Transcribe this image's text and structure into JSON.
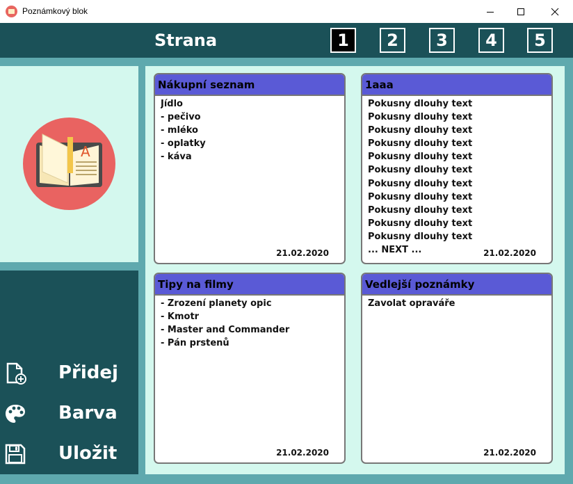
{
  "window": {
    "title": "Poznámkový blok",
    "app_icon": "notebook-app-icon",
    "controls": [
      "minimize-icon",
      "maximize-icon",
      "close-icon"
    ]
  },
  "header": {
    "label": "Strana",
    "pages": [
      "1",
      "2",
      "3",
      "4",
      "5"
    ],
    "active_page": "1"
  },
  "sidebar": {
    "logo_icon": "open-book-icon",
    "actions": [
      {
        "label": "Přidej",
        "icon": "add-file-icon"
      },
      {
        "label": "Barva",
        "icon": "palette-icon"
      },
      {
        "label": "Uložit",
        "icon": "save-icon"
      }
    ]
  },
  "notes": [
    {
      "title": "Nákupní seznam",
      "lines": [
        "Jídlo",
        "- pečivo",
        "- mléko",
        "- oplatky",
        "- káva"
      ],
      "date": "21.02.2020"
    },
    {
      "title": "1aaa",
      "lines": [
        "Pokusny dlouhy text",
        "Pokusny dlouhy text",
        "Pokusny dlouhy text",
        "Pokusny dlouhy text",
        "Pokusny dlouhy text",
        "Pokusny dlouhy text",
        "Pokusny dlouhy text",
        "Pokusny dlouhy text",
        "Pokusny dlouhy text",
        "Pokusny dlouhy text",
        "Pokusny dlouhy text",
        "... NEXT ..."
      ],
      "date": "21.02.2020"
    },
    {
      "title": "Tipy na filmy",
      "lines": [
        "- Zrození planety opic",
        "- Kmotr",
        "- Master and Commander",
        "- Pán prstenů"
      ],
      "date": "21.02.2020"
    },
    {
      "title": "Vedlejší poznámky",
      "lines": [
        "Zavolat opraváře"
      ],
      "date": "21.02.2020"
    }
  ],
  "colors": {
    "header_bg": "#1b5158",
    "panel_light": "#d4f8ee",
    "frame": "#5fa9ae",
    "note_title_bg": "#5a5ad6",
    "logo_circle": "#e96361"
  }
}
